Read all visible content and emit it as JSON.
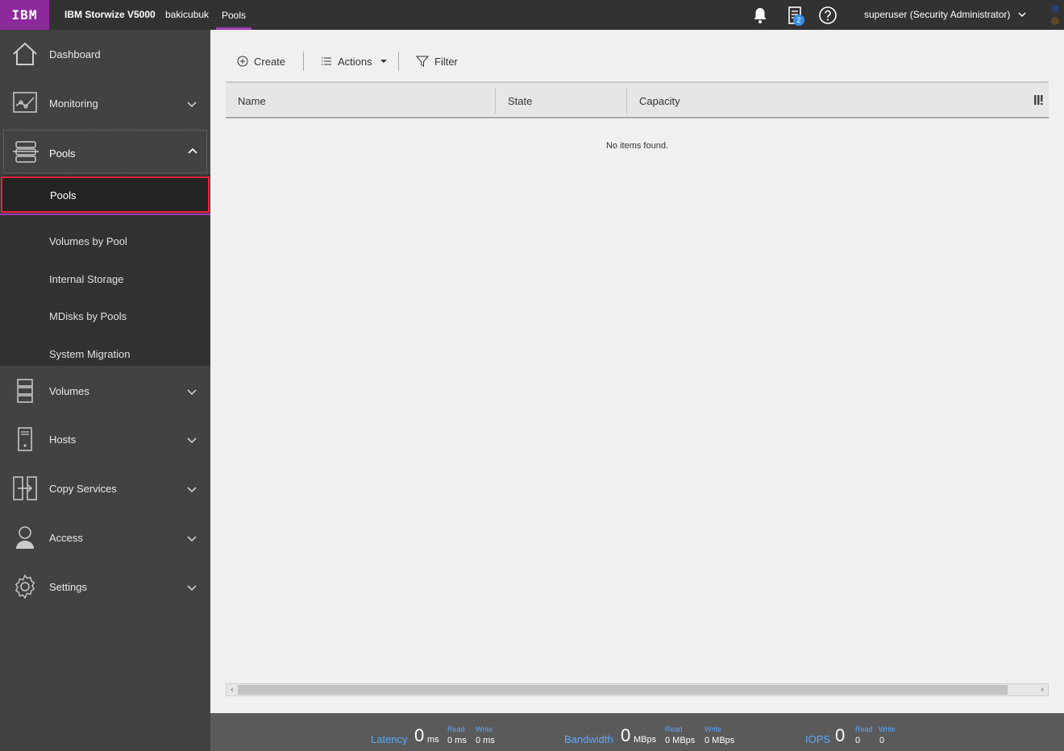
{
  "topbar": {
    "logo": "IBM",
    "product": "IBM Storwize V5000",
    "system_name": "bakicubuk",
    "breadcrumb": "Pools",
    "tasks_badge": "2",
    "user": "superuser (Security Administrator)"
  },
  "sidebar": {
    "items": [
      {
        "label": "Dashboard",
        "icon": "home-icon"
      },
      {
        "label": "Monitoring",
        "icon": "monitoring-icon"
      },
      {
        "label": "Pools",
        "icon": "pools-icon"
      },
      {
        "label": "Volumes",
        "icon": "volumes-icon"
      },
      {
        "label": "Hosts",
        "icon": "hosts-icon"
      },
      {
        "label": "Copy Services",
        "icon": "copy-services-icon"
      },
      {
        "label": "Access",
        "icon": "access-icon"
      },
      {
        "label": "Settings",
        "icon": "settings-icon"
      }
    ],
    "pools_submenu": [
      "Pools",
      "Volumes by Pool",
      "Internal Storage",
      "MDisks by Pools",
      "System Migration"
    ]
  },
  "toolbar": {
    "create": "Create",
    "actions": "Actions",
    "filter": "Filter"
  },
  "table": {
    "columns": [
      "Name",
      "State",
      "Capacity"
    ],
    "empty_message": "No items found."
  },
  "performance": {
    "latency": {
      "label": "Latency",
      "value": "0",
      "unit": "ms",
      "read_label": "Read",
      "read_value": "0 ms",
      "write_label": "Write",
      "write_value": "0 ms"
    },
    "bandwidth": {
      "label": "Bandwidth",
      "value": "0",
      "unit": "MBps",
      "read_label": "Read",
      "read_value": "0 MBps",
      "write_label": "Write",
      "write_value": "0 MBps"
    },
    "iops": {
      "label": "IOPS",
      "value": "0",
      "unit": "",
      "read_label": "Read",
      "read_value": "0",
      "write_label": "Write",
      "write_value": "0"
    }
  },
  "colors": {
    "brand": "#8c2a9c",
    "accent_underline": "#a23dbb",
    "selected_border": "#e8253b",
    "perf_label": "#5aa9ff"
  }
}
